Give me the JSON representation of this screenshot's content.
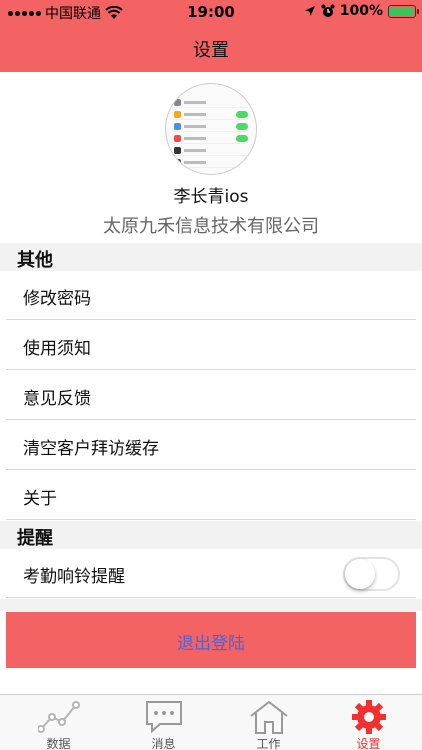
{
  "status_bar": {
    "carrier": "中国联通",
    "time": "19:00",
    "battery": "100%",
    "battery_level": 1.0,
    "icons": [
      "signal-dots-icon",
      "wifi-icon",
      "location-arrow-icon",
      "alarm-icon",
      "battery-icon"
    ]
  },
  "nav": {
    "title": "设置"
  },
  "profile": {
    "name": "李长青ios",
    "company": "太原九禾信息技术有限公司",
    "avatar_icon": "app-screenshot-avatar"
  },
  "sections": {
    "other": {
      "header": "其他",
      "items": [
        "修改密码",
        "使用须知",
        "意见反馈",
        "清空客户拜访缓存",
        "关于"
      ]
    },
    "reminder": {
      "header": "提醒",
      "item_label": "考勤响铃提醒",
      "toggle_on": false
    }
  },
  "logout": {
    "label": "退出登陆"
  },
  "tabs": [
    {
      "label": "数据",
      "icon": "line-chart-icon",
      "active": false
    },
    {
      "label": "消息",
      "icon": "chat-bubble-icon",
      "active": false
    },
    {
      "label": "工作",
      "icon": "home-icon",
      "active": false
    },
    {
      "label": "设置",
      "icon": "gear-icon",
      "active": true
    }
  ],
  "colors": {
    "header_red": "#f46363",
    "logout_text": "#4b63d8",
    "active_tab": "#f23030",
    "section_bg": "#f2f2f2"
  }
}
